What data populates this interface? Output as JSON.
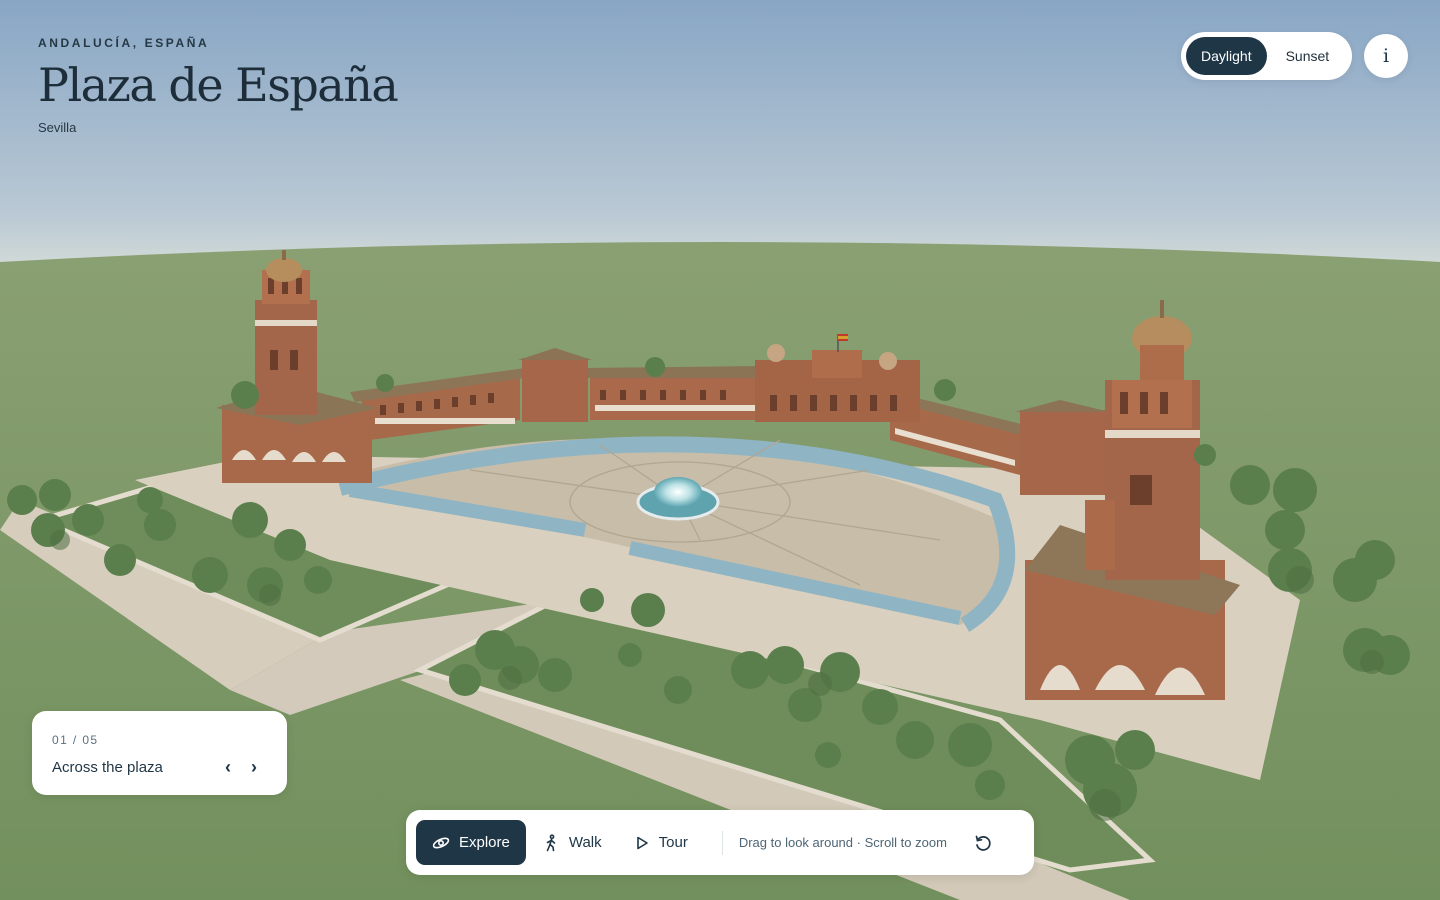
{
  "header": {
    "eyebrow": "ANDALUCÍA, ESPAÑA",
    "title": "Plaza de España",
    "subtitle": "Sevilla"
  },
  "lighting_toggle": {
    "options": [
      "Daylight",
      "Sunset"
    ],
    "selected": "Daylight"
  },
  "info_button": {
    "label": "i"
  },
  "stop_card": {
    "counter": "01 / 05",
    "current": 1,
    "total": 5,
    "title": "Across the plaza",
    "prev_label": "‹",
    "next_label": "›"
  },
  "toolbar": {
    "modes": [
      {
        "label": "Explore",
        "icon": "orbit-icon"
      },
      {
        "label": "Walk",
        "icon": "walk-icon"
      },
      {
        "label": "Tour",
        "icon": "play-icon"
      }
    ],
    "active_mode": "Explore",
    "hint": "Drag to look around · Scroll to zoom",
    "reset_icon": "reset-view-icon"
  },
  "colors": {
    "sky_top": "#8aa8c7",
    "sky_horizon": "#dfe4d9",
    "ground": "#7b9465",
    "brick": "#a96847",
    "roof": "#8d7456",
    "plaza": "#ccc3b1",
    "water": "#8fb4c4",
    "tree": "#5b7f4c",
    "accent": "#1f3646"
  }
}
